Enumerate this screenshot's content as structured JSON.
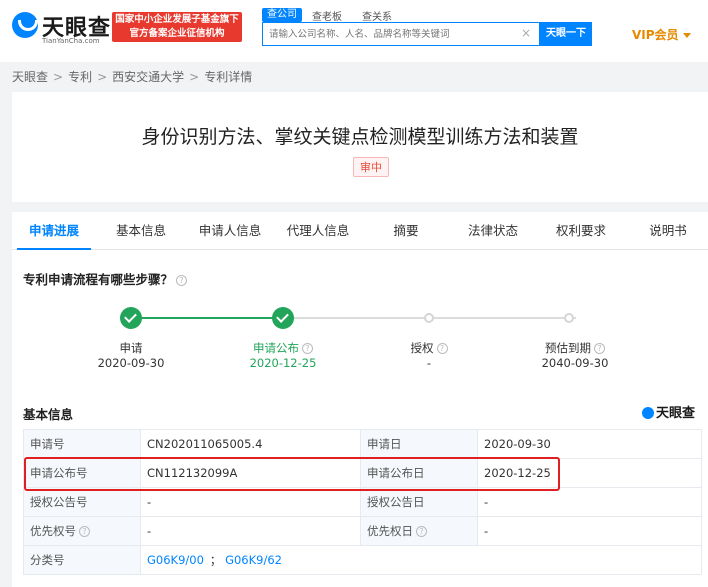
{
  "header": {
    "logo_text": "天眼查",
    "logo_sub": "TianYanCha.com",
    "banner_line1": "国家中小企业发展子基金旗下",
    "banner_line2": "官方备案企业征信机构",
    "search_tabs": [
      "查公司",
      "查老板",
      "查关系"
    ],
    "search_placeholder": "请输入公司名称、人名、品牌名称等关键词",
    "search_clear": "×",
    "search_button": "天眼一下",
    "vip_label": "VIP会员"
  },
  "breadcrumb": [
    "天眼查",
    "专利",
    "西安交通大学",
    "专利详情"
  ],
  "breadcrumb_sep": ">",
  "patent": {
    "title": "身份识别方法、掌纹关键点检测模型训练方法和装置",
    "status": "审中"
  },
  "tabs": [
    "申请进展",
    "基本信息",
    "申请人信息",
    "代理人信息",
    "摘要",
    "法律状态",
    "权利要求",
    "说明书"
  ],
  "active_tab": "申请进展",
  "steps": {
    "heading": "专利申请流程有哪些步骤？",
    "help": "?",
    "items": [
      {
        "label": "申请",
        "date": "2020-09-30",
        "done": true
      },
      {
        "label": "申请公布",
        "date": "2020-12-25",
        "done": true
      },
      {
        "label": "授权",
        "date": "-",
        "done": false
      },
      {
        "label": "预估到期",
        "date": "2040-09-30",
        "done": false
      }
    ]
  },
  "basic_info": {
    "heading": "基本信息",
    "brand": "天眼查",
    "rows": [
      {
        "k1": "申请号",
        "v1": "CN202011065005.4",
        "k2": "申请日",
        "v2": "2020-09-30"
      },
      {
        "k1": "申请公布号",
        "v1": "CN112132099A",
        "k2": "申请公布日",
        "v2": "2020-12-25"
      },
      {
        "k1": "授权公告号",
        "v1": "-",
        "k2": "授权公告日",
        "v2": "-"
      },
      {
        "k1": "优先权号",
        "v1": "-",
        "k2": "优先权日",
        "v2": "-"
      }
    ],
    "class_label": "分类号",
    "class_links": [
      "G06K9/00",
      "G06K9/62"
    ],
    "class_sep": "；"
  },
  "colors": {
    "accent": "#0084ff",
    "success": "#22a55a",
    "highlight": "#e02020",
    "status": "#e84c3d"
  }
}
